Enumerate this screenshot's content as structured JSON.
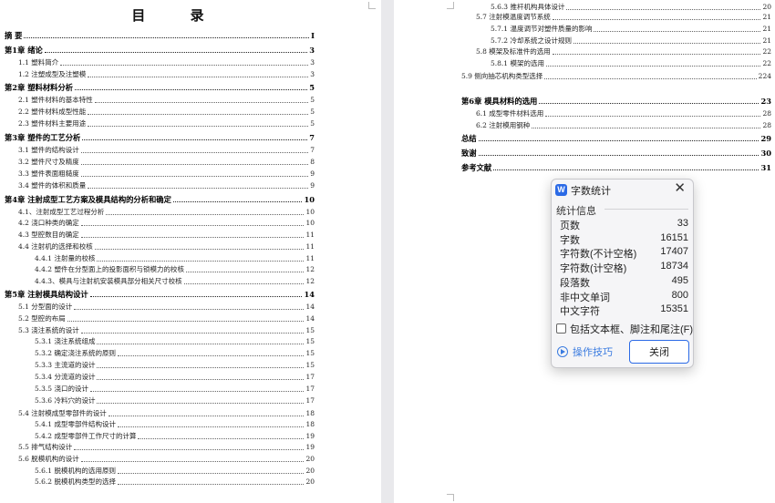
{
  "toc": {
    "title": "目  录",
    "left": [
      {
        "label": "摘  要",
        "page": "I",
        "bold": true
      },
      {
        "label": "第1章  绪论",
        "page": "3",
        "bold": true
      },
      {
        "label": "1.1    塑料简介",
        "page": "3",
        "bold": false
      },
      {
        "label": "1.2    注塑成型及注塑模",
        "page": "3",
        "bold": false
      },
      {
        "label": "第2章  塑料材料分析",
        "page": "5",
        "bold": true
      },
      {
        "label": "2.1  塑件材料的基本特性",
        "page": "5",
        "bold": false
      },
      {
        "label": "2.2  塑件材料成型性能",
        "page": "5",
        "bold": false
      },
      {
        "label": "2.3  塑件材料主要用途",
        "page": "5",
        "bold": false
      },
      {
        "label": "第3章  塑件的工艺分析",
        "page": "7",
        "bold": true
      },
      {
        "label": "3.1  塑件的结构设计",
        "page": "7",
        "bold": false
      },
      {
        "label": "3.2  塑件尺寸及精度",
        "page": "8",
        "bold": false
      },
      {
        "label": "3.3  塑件表面粗糙度",
        "page": "9",
        "bold": false
      },
      {
        "label": "3.4  塑件的体积和质量",
        "page": "9",
        "bold": false
      },
      {
        "label": "第4章  注射成型工艺方案及模具结构的分析和确定",
        "page": "10",
        "bold": true
      },
      {
        "label": "4.1、注射成型工艺过程分析",
        "page": "10",
        "bold": false
      },
      {
        "label": "4.2    浇口种类的确定",
        "page": "10",
        "bold": false
      },
      {
        "label": "4.3  型腔数目的确定",
        "page": "11",
        "bold": false
      },
      {
        "label": "4.4    注射机的选择和校核",
        "page": "11",
        "bold": false
      },
      {
        "label": "4.4.1  注射量的校核",
        "page": "11",
        "bold": false
      },
      {
        "label": "4.4.2  塑件在分型面上的投影面积与锁模力的校核",
        "page": "12",
        "bold": false
      },
      {
        "label": "4.4.3、模具与注射机安装模具部分相关尺寸校核",
        "page": "12",
        "bold": false
      },
      {
        "label": "第5章  注射模具结构设计",
        "page": "14",
        "bold": true
      },
      {
        "label": "5.1  分型面的设计",
        "page": "14",
        "bold": false
      },
      {
        "label": "5.2  型腔的布局",
        "page": "14",
        "bold": false
      },
      {
        "label": "5.3  浇注系统的设计",
        "page": "15",
        "bold": false
      },
      {
        "label": "5.3.1  浇注系统组成",
        "page": "15",
        "bold": false
      },
      {
        "label": "5.3.2  确定浇注系统的原则",
        "page": "15",
        "bold": false
      },
      {
        "label": "5.3.3  主流道的设计",
        "page": "15",
        "bold": false
      },
      {
        "label": "5.3.4  分流道的设计",
        "page": "17",
        "bold": false
      },
      {
        "label": "5.3.5  浇口的设计",
        "page": "17",
        "bold": false
      },
      {
        "label": "5.3.6  冷料穴的设计",
        "page": "17",
        "bold": false
      },
      {
        "label": "5.4  注射模成型零部件的设计",
        "page": "18",
        "bold": false
      },
      {
        "label": "5.4.1  成型零部件结构设计",
        "page": "18",
        "bold": false
      },
      {
        "label": "5.4.2  成型零部件工作尺寸的计算",
        "page": "19",
        "bold": false
      },
      {
        "label": "5.5  排气结构设计",
        "page": "19",
        "bold": false
      },
      {
        "label": "5.6  脱模机构的设计",
        "page": "20",
        "bold": false
      },
      {
        "label": "5.6.1  脱模机构的选用原则",
        "page": "20",
        "bold": false
      },
      {
        "label": "5.6.2  脱模机构类型的选择",
        "page": "20",
        "bold": false
      }
    ],
    "right": [
      {
        "label": "5.6.3  推杆机构具体设计",
        "page": "20",
        "bold": false
      },
      {
        "label": "5.7  注射模温度调节系统",
        "page": "21",
        "bold": false
      },
      {
        "label": "5.7.1  温度调节对塑件质量的影响",
        "page": "21",
        "bold": false
      },
      {
        "label": "5.7.2    冷却系统之设计规则",
        "page": "21",
        "bold": false
      },
      {
        "label": "5.8  模架及标准件的选用",
        "page": "22",
        "bold": false
      },
      {
        "label": "5.8.1  模架的选用",
        "page": "22",
        "bold": false
      },
      {
        "label": "5.9 侧向抽芯机构类型选择",
        "page": "224",
        "bold": false
      },
      {
        "label": "第6章  模具材料的选用",
        "page": "23",
        "bold": true
      },
      {
        "label": "6.1  成型零件材料选用",
        "page": "28",
        "bold": false
      },
      {
        "label": "6.2  注射模用钢种",
        "page": "28",
        "bold": false
      },
      {
        "label": "总结",
        "page": "29",
        "bold": true
      },
      {
        "label": "致谢",
        "page": "30",
        "bold": true
      },
      {
        "label": "参考文献",
        "page": "31",
        "bold": true
      }
    ]
  },
  "dialog": {
    "app_icon_letter": "W",
    "title": "字数统计",
    "close_glyph": "✕",
    "section": "统计信息",
    "stats": [
      {
        "key": "页数",
        "value": "33"
      },
      {
        "key": "字数",
        "value": "16151"
      },
      {
        "key": "字符数(不计空格)",
        "value": "17407"
      },
      {
        "key": "字符数(计空格)",
        "value": "18734"
      },
      {
        "key": "段落数",
        "value": "495"
      },
      {
        "key": "非中文单词",
        "value": "800"
      },
      {
        "key": "中文字符",
        "value": "15351"
      }
    ],
    "checkbox_label": "包括文本框、脚注和尾注(F)",
    "tips_label": "操作技巧",
    "close_button": "关闭"
  }
}
